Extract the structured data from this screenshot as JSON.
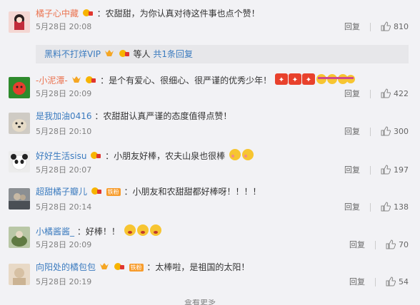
{
  "comments": [
    {
      "nick": "橘子心中藏",
      "content": "：农甜甜，为你认真对待这件事也点个赞！",
      "time": "5月28日 20:08",
      "reply": "回复",
      "likes": "810"
    },
    {
      "nick": "-小泥潭-",
      "content": "：是个有爱心、很细心、很严谨的优秀少年！",
      "time": "5月28日 20:09",
      "reply": "回复",
      "likes": "422"
    },
    {
      "nick": "是我加油0416",
      "content": "：农甜甜认真严谨的态度值得点赞！",
      "time": "5月28日 20:10",
      "reply": "回复",
      "likes": "300"
    },
    {
      "nick": "好好生活sisu",
      "content": "：小朋友好棒，农夫山泉也很棒",
      "time": "5月28日 20:07",
      "reply": "回复",
      "likes": "197"
    },
    {
      "nick": "超甜橘子瓣儿",
      "content": "：小朋友和农甜甜都好棒呀！！！！",
      "time": "5月28日 20:14",
      "reply": "回复",
      "likes": "138"
    },
    {
      "nick": "小橘酱酱_",
      "content": "：好棒！！",
      "time": "5月28日 20:09",
      "reply": "回复",
      "likes": "70"
    },
    {
      "nick": "向阳处的橘包包",
      "content": "：太棒啦，是祖国的太阳！",
      "time": "5月28日 20:19",
      "reply": "回复",
      "likes": "54"
    }
  ],
  "sub_reply": {
    "nick": "黑料不打烊VIP",
    "suffix": "等人",
    "count_link": "共1条回复"
  },
  "fan_badge": "铁粉",
  "more": "查看更多",
  "icons": {
    "like": "thumbs-up-icon",
    "vip": "vip-crown-icon",
    "member": "member-badge-icon"
  },
  "colors": {
    "nick": "#eb7350",
    "nick_blue": "#3b7bbf",
    "meta": "#808080",
    "bg": "#f2f2f5"
  }
}
